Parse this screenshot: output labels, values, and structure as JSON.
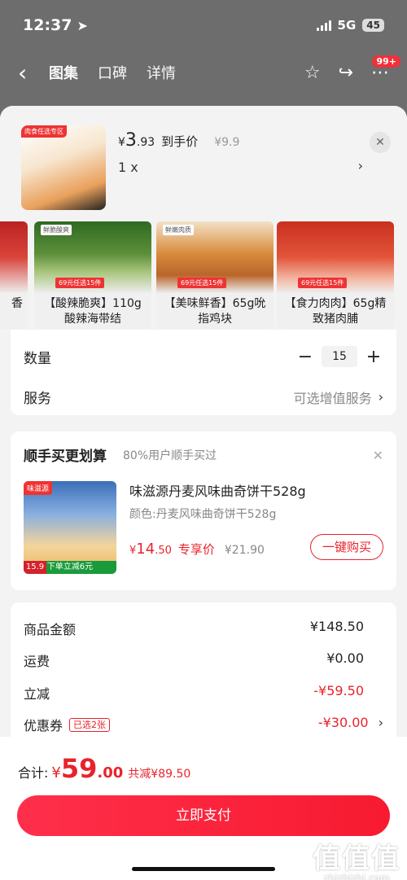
{
  "status_bar": {
    "time": "12:37",
    "network": "5G",
    "battery": "45"
  },
  "top_nav": {
    "tabs": [
      "图集",
      "口碑",
      "详情"
    ],
    "badge": "99+"
  },
  "summary": {
    "thumb_tag": "肉食任选专区",
    "price_currency": "¥",
    "price_int": "3",
    "price_dec": ".93",
    "price_label": "到手价",
    "original_price": "¥9.9",
    "quantity": "1 x"
  },
  "variants": [
    {
      "name": "香",
      "chip": "",
      "promo": ""
    },
    {
      "name": "【酸辣脆爽】110g酸辣海带结",
      "chip": "鲜脆酸爽",
      "promo": "69元任选15件"
    },
    {
      "name": "【美味鲜香】65g吮指鸡块",
      "chip": "鲜嫩肉质",
      "promo": "69元任选15件"
    },
    {
      "name": "【食力肉肉】65g精致猪肉脯",
      "chip": "",
      "promo": "69元任选15件"
    }
  ],
  "options": {
    "quantity_label": "数量",
    "quantity_value": "15",
    "service_label": "服务",
    "service_value": "可选增值服务"
  },
  "addon": {
    "title": "顺手买更划算",
    "subtitle": "80%用户顺手买过",
    "img_tag": "味滋源",
    "img_foot": "下单立减6元",
    "img_price": "15.9",
    "name": "味滋源丹麦风味曲奇饼干528g",
    "spec": "颜色:丹麦风味曲奇饼干528g",
    "price_currency": "¥",
    "price_int": "14",
    "price_dec": ".50",
    "price_label": "专享价",
    "original_price": "¥21.90",
    "buy_label": "一键购买"
  },
  "breakdown": [
    {
      "label": "商品金额",
      "value": "¥148.50"
    },
    {
      "label": "运费",
      "value": "¥0.00"
    },
    {
      "label": "立减",
      "value": "-¥59.50"
    },
    {
      "label": "优惠券",
      "value": "-¥30.00",
      "badge": "已选2张"
    }
  ],
  "footer": {
    "total_label": "合计:",
    "total_currency": "¥",
    "total_int": "59",
    "total_dec": ".00",
    "saved": "共减¥89.50",
    "pay_label": "立即支付"
  },
  "watermark": {
    "big": "值值值",
    "small": "zhizhizhi.com"
  },
  "colors": {
    "accent": "#e8232b",
    "pay_button": "#f71a30",
    "sheet_bg": "#f3f3f3"
  }
}
